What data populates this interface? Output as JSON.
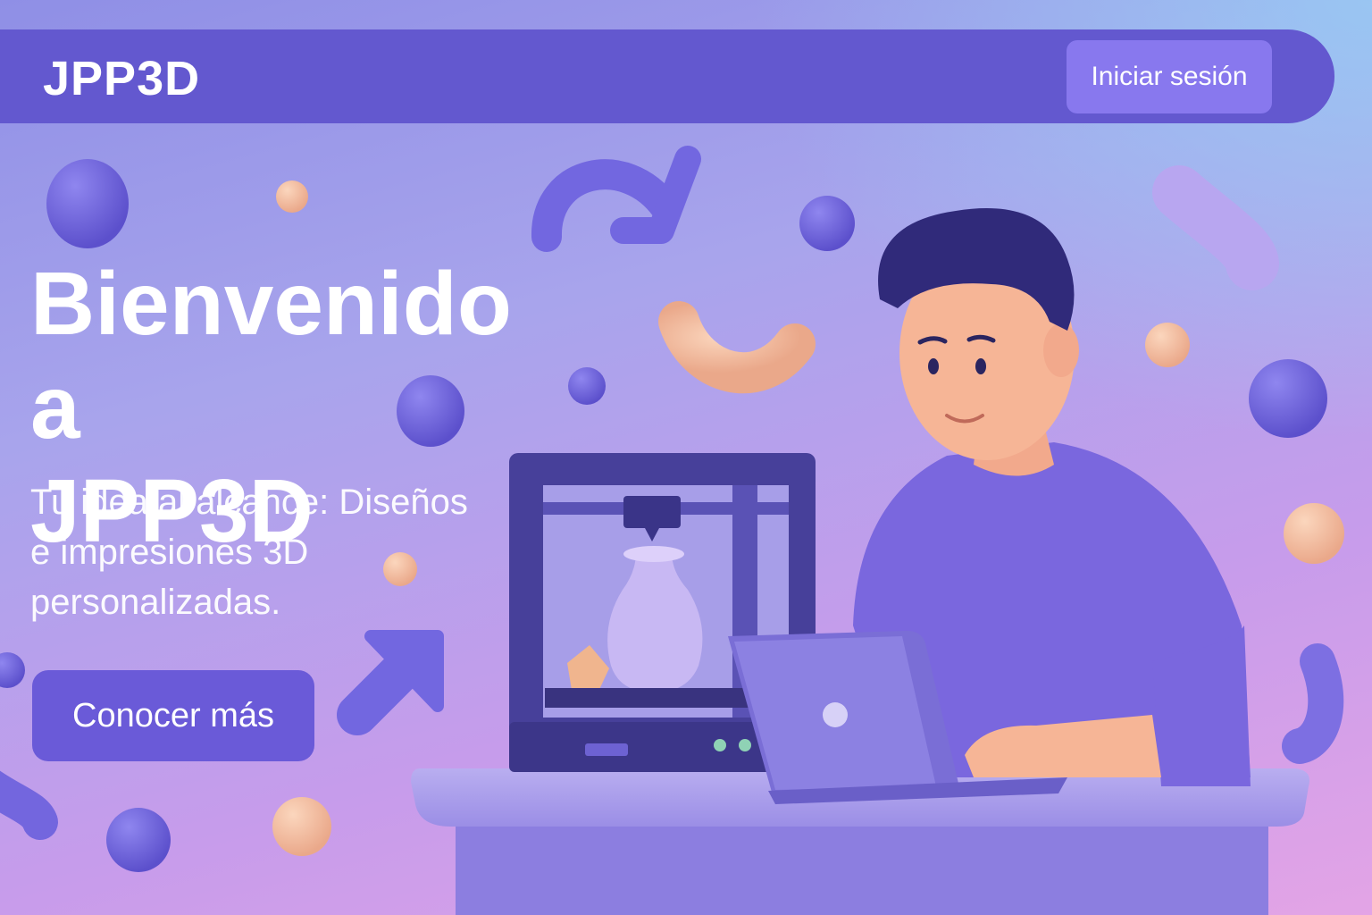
{
  "header": {
    "brand": "JPP3D",
    "login_label": "Iniciar sesión"
  },
  "hero": {
    "title_line1": "Bienvenido a",
    "title_line2": "JPP3D",
    "subtitle_line1": "Tu idea al alcance: Diseños",
    "subtitle_line2": "e impresiones 3D",
    "subtitle_line3": "personalizadas.",
    "cta_label": "Conocer más"
  },
  "colors": {
    "nav_bg": "#6358cf",
    "button_bg": "#8878ee",
    "cta_bg": "#6a5ad8",
    "shape_purple": "#6e62da",
    "shape_peach": "#f2bfa0"
  },
  "illustration": {
    "subject": "person-using-laptop-with-3d-printer",
    "icons": [
      "3d-printer-icon",
      "laptop-icon",
      "vase-icon",
      "arrow-icon"
    ]
  }
}
